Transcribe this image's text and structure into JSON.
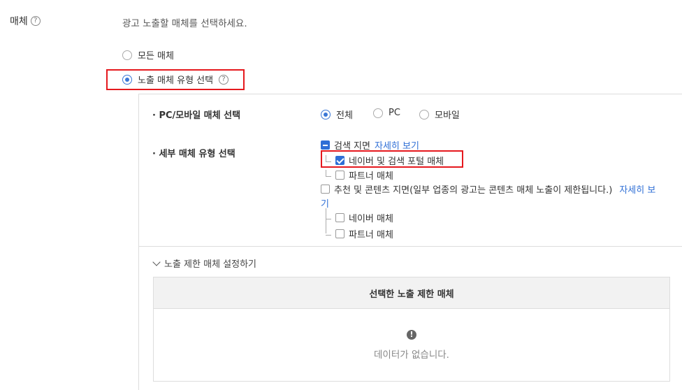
{
  "media": {
    "label": "매체",
    "instruction": "광고 노출할 매체를 선택하세요.",
    "options": {
      "all": "모든 매체",
      "select_type": "노출 매체 유형 선택"
    },
    "help_glyph": "?"
  },
  "panel": {
    "device": {
      "label": "· PC/모바일 매체 선택",
      "options": [
        "전체",
        "PC",
        "모바일"
      ],
      "selected": "전체"
    },
    "detail": {
      "label": "· 세부 매체 유형 선택",
      "search_group": {
        "label": "검색 지면",
        "link": "자세히 보기",
        "naver": "네이버 및 검색 포털 매체",
        "partner": "파트너 매체"
      },
      "content_group": {
        "label": "추천 및 콘텐츠 지면(일부 업종의 광고는 콘텐츠 매체 노출이 제한됩니다.)",
        "link_a": "자세히 보",
        "link_b": "기",
        "naver": "네이버 매체",
        "partner": "파트너 매체"
      }
    },
    "restrict_toggle": "노출 제한 매체 설정하기",
    "table": {
      "header": "선택한 노출 제한 매체",
      "empty_icon": "!",
      "empty": "데이터가 없습니다."
    }
  },
  "colors": {
    "accent": "#2f6fd6",
    "highlight": "#e5191e"
  }
}
